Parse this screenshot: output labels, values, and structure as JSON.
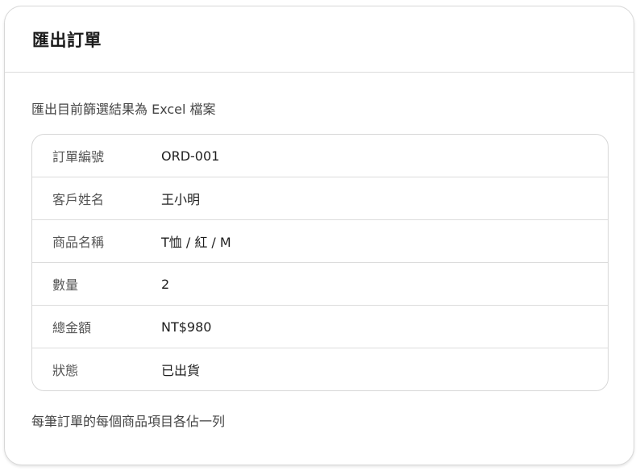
{
  "dialog": {
    "title": "匯出訂單",
    "description": "匯出目前篩選結果為 Excel 檔案",
    "footnote": "每筆訂單的每個商品項目各佔一列"
  },
  "preview_rows": [
    {
      "label": "訂單編號",
      "value": "ORD-001"
    },
    {
      "label": "客戶姓名",
      "value": "王小明"
    },
    {
      "label": "商品名稱",
      "value": "T恤 / 紅 / M"
    },
    {
      "label": "數量",
      "value": "2"
    },
    {
      "label": "總金額",
      "value": "NT$980"
    },
    {
      "label": "狀態",
      "value": "已出貨"
    }
  ]
}
